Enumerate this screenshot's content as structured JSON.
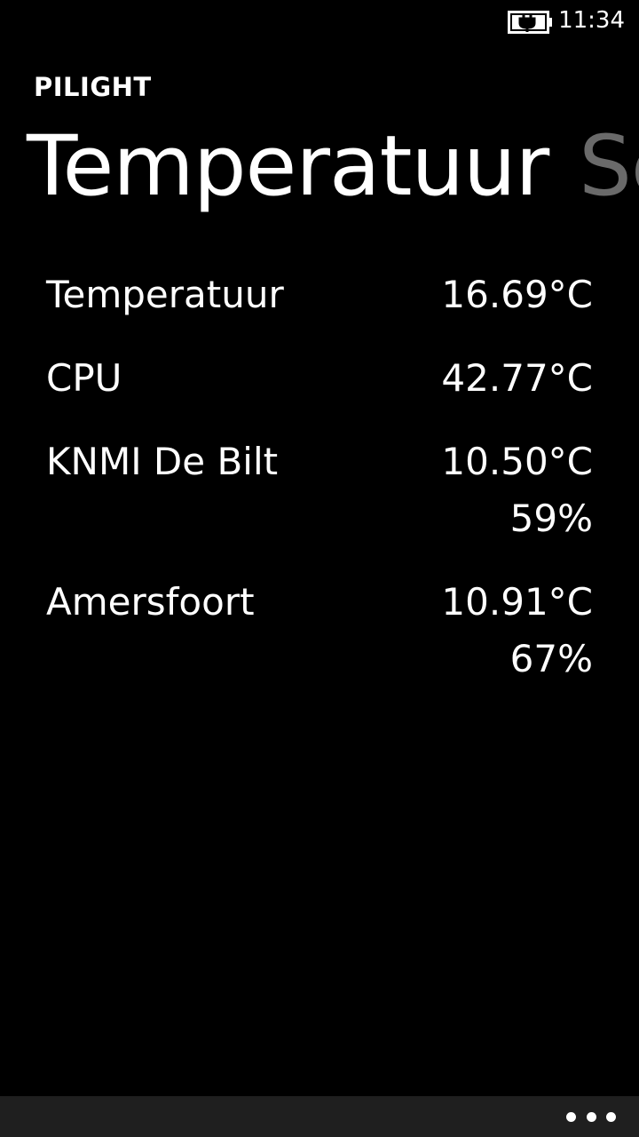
{
  "status_bar": {
    "time": "11:34",
    "battery_icon": "battery-charging-icon"
  },
  "app": {
    "title": "PILIGHT"
  },
  "pivot": {
    "items": [
      {
        "label": "Temperatuur",
        "active": true
      },
      {
        "label": "Se",
        "active": false
      }
    ]
  },
  "sensors": [
    {
      "name": "Temperatuur",
      "values": [
        "16.69°C"
      ]
    },
    {
      "name": "CPU",
      "values": [
        "42.77°C"
      ]
    },
    {
      "name": "KNMI De Bilt",
      "values": [
        "10.50°C",
        "59%"
      ]
    },
    {
      "name": "Amersfoort",
      "values": [
        "10.91°C",
        "67%"
      ]
    }
  ],
  "app_bar": {
    "more_icon": "more-dots-icon"
  },
  "colors": {
    "background": "#000000",
    "text": "#ffffff",
    "inactive_pivot": "#6a6a6a",
    "app_bar": "#1f1f1f"
  }
}
